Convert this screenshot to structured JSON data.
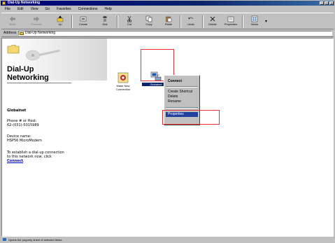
{
  "window": {
    "title": "Dial-Up Networking"
  },
  "menu": [
    "File",
    "Edit",
    "View",
    "Go",
    "Favorites",
    "Connections",
    "Help"
  ],
  "toolbar": {
    "back": "Back",
    "forward": "Forward",
    "up": "Up",
    "create": "Create",
    "dial": "Dial",
    "cut": "Cut",
    "copy": "Copy",
    "paste": "Paste",
    "undo": "Undo",
    "delete": "Delete",
    "properties": "Properties",
    "views": "Views"
  },
  "address": {
    "label": "Address",
    "value": "Dial-Up Networking"
  },
  "leftpane": {
    "title_line1": "Dial-Up",
    "title_line2": "Networking",
    "connection_name": "Globalnet",
    "phone_label": "Phone # or Host:",
    "phone_value": "62-(031)-5015989",
    "device_label": "Device name:",
    "device_value": "HSP56 MicroModem",
    "instruction_line1": "To establish a dial-up connection",
    "instruction_line2": "to this network now, click",
    "connect_link": "Connect"
  },
  "icons": [
    {
      "line1": "Make New",
      "line2": "Connection"
    },
    {
      "line1": "Globalnet",
      "line2": ""
    }
  ],
  "context_menu": {
    "connect": "Connect",
    "create_shortcut": "Create Shortcut",
    "delete": "Delete",
    "rename": "Rename",
    "properties": "Properties"
  },
  "statusbar": {
    "text": "Opens the property sheet of selected items."
  },
  "colors": {
    "selection": "#0a246a",
    "annotation": "#e83030",
    "link": "#0000c0"
  }
}
